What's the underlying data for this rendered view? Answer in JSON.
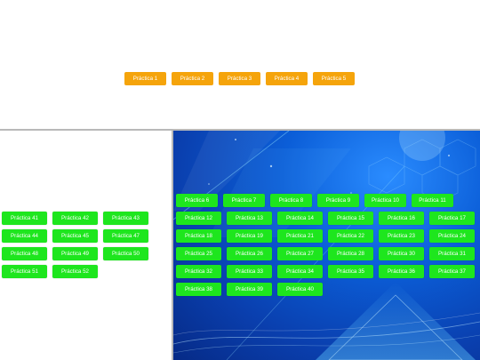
{
  "top_buttons": [
    "Práctica 1",
    "Práctica 2",
    "Práctica 3",
    "Práctica 4",
    "Práctica 5"
  ],
  "left_buttons": [
    "Práctica 41",
    "Práctica 42",
    "Práctica 43",
    "Práctica 44",
    "Práctica 45",
    "Práctica 47",
    "Práctica 48",
    "Práctica 49",
    "Práctica 50",
    "Práctica 51",
    "Práctica 52"
  ],
  "right_row1": [
    "Práctica 6",
    "Práctica 7",
    "Práctica 8",
    "Práctica 9",
    "Práctica 10",
    "Práctica 11"
  ],
  "right_buttons": [
    "Práctica 12",
    "Práctica 13",
    "Práctica 14",
    "Práctica 15",
    "Práctica 16",
    "Práctica 17",
    "Práctica 18",
    "Práctica 19",
    "Práctica 21",
    "Práctica 22",
    "Práctica 23",
    "Práctica 24",
    "Práctica 25",
    "Práctica 26",
    "Práctica 27",
    "Práctica 28",
    "Práctica 30",
    "Práctica 31",
    "Práctica 32",
    "Práctica 33",
    "Práctica 34",
    "Práctica 35",
    "Práctica 36",
    "Práctica 37",
    "Práctica 38",
    "Práctica 39",
    "Práctica 40"
  ],
  "colors": {
    "orange_button": "#f5a40b",
    "green_button": "#1ee61e",
    "panel_blue": "#0b5ed8",
    "divider": "#b9b9b9"
  }
}
